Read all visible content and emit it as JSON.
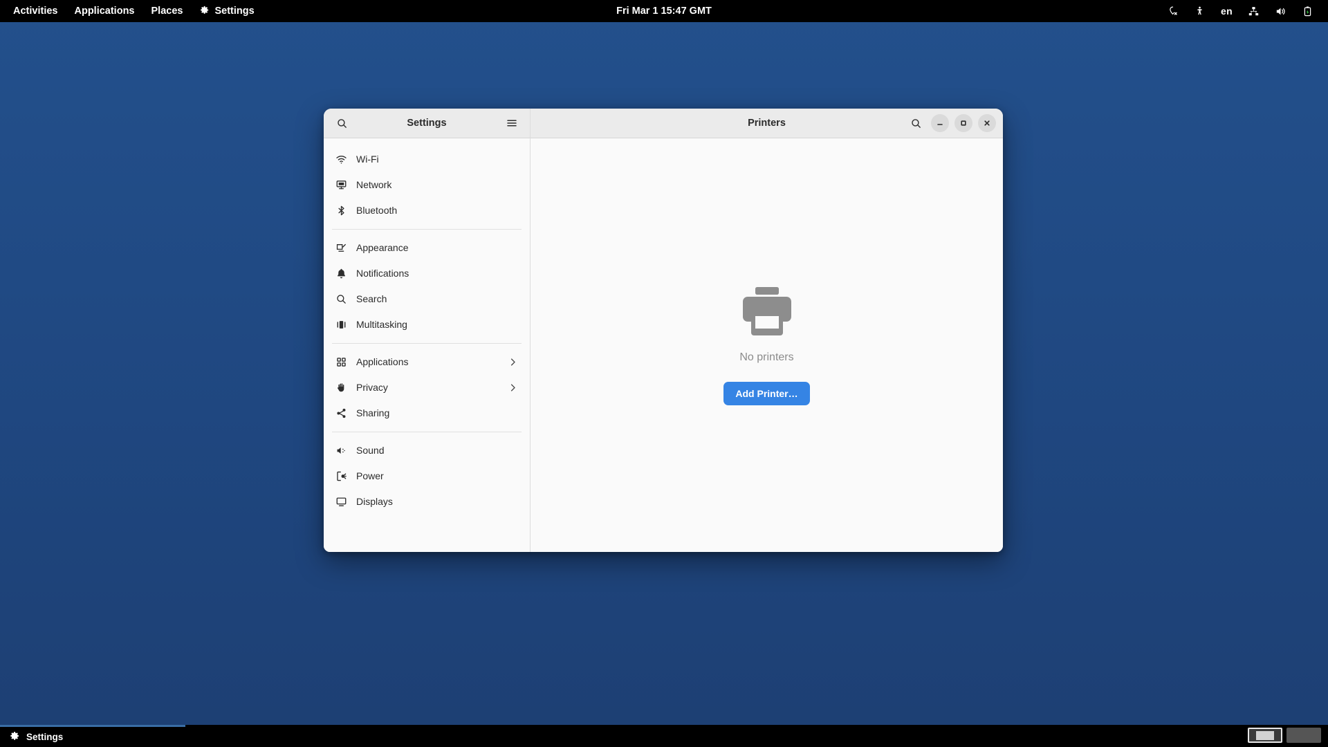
{
  "top_panel": {
    "activities": "Activities",
    "applications": "Applications",
    "places": "Places",
    "settings": "Settings",
    "clock": "Fri Mar 1  15:47 GMT",
    "tray": {
      "location_icon": "location-disabled-icon",
      "accessibility_icon": "accessibility-icon",
      "keyboard_layout": "en",
      "network_icon": "network-wired-icon",
      "volume_icon": "volume-icon",
      "battery_icon": "battery-charging-icon"
    }
  },
  "window": {
    "sidebar_header": {
      "title": "Settings",
      "search_icon": "search-icon",
      "menu_icon": "hamburger-menu-icon"
    },
    "content_header": {
      "title": "Printers",
      "search_icon": "search-icon",
      "minimize": "minimize-icon",
      "maximize": "maximize-icon",
      "close": "close-icon"
    },
    "sidebar_groups": [
      {
        "items": [
          {
            "label": "Wi-Fi",
            "icon": "wifi-icon",
            "chevron": false
          },
          {
            "label": "Network",
            "icon": "network-icon",
            "chevron": false
          },
          {
            "label": "Bluetooth",
            "icon": "bluetooth-icon",
            "chevron": false
          }
        ]
      },
      {
        "items": [
          {
            "label": "Appearance",
            "icon": "appearance-icon",
            "chevron": false
          },
          {
            "label": "Notifications",
            "icon": "bell-icon",
            "chevron": false
          },
          {
            "label": "Search",
            "icon": "search-icon",
            "chevron": false
          },
          {
            "label": "Multitasking",
            "icon": "multitasking-icon",
            "chevron": false
          }
        ]
      },
      {
        "items": [
          {
            "label": "Applications",
            "icon": "grid-icon",
            "chevron": true
          },
          {
            "label": "Privacy",
            "icon": "hand-icon",
            "chevron": true
          },
          {
            "label": "Sharing",
            "icon": "share-icon",
            "chevron": false
          }
        ]
      },
      {
        "items": [
          {
            "label": "Sound",
            "icon": "sound-icon",
            "chevron": false
          },
          {
            "label": "Power",
            "icon": "power-icon",
            "chevron": false
          },
          {
            "label": "Displays",
            "icon": "display-icon",
            "chevron": false
          }
        ]
      }
    ],
    "content": {
      "printer_icon": "printer-icon",
      "empty_title": "No printers",
      "add_printer_label": "Add Printer…"
    }
  },
  "taskbar": {
    "window_button": "Settings",
    "window_icon": "gear-icon",
    "workspaces": [
      {
        "active": true
      },
      {
        "active": false
      }
    ]
  },
  "colors": {
    "accent": "#3584e4",
    "desktop": "#214a84",
    "panel": "#000000",
    "header": "#ebebeb",
    "body": "#fafafa"
  }
}
